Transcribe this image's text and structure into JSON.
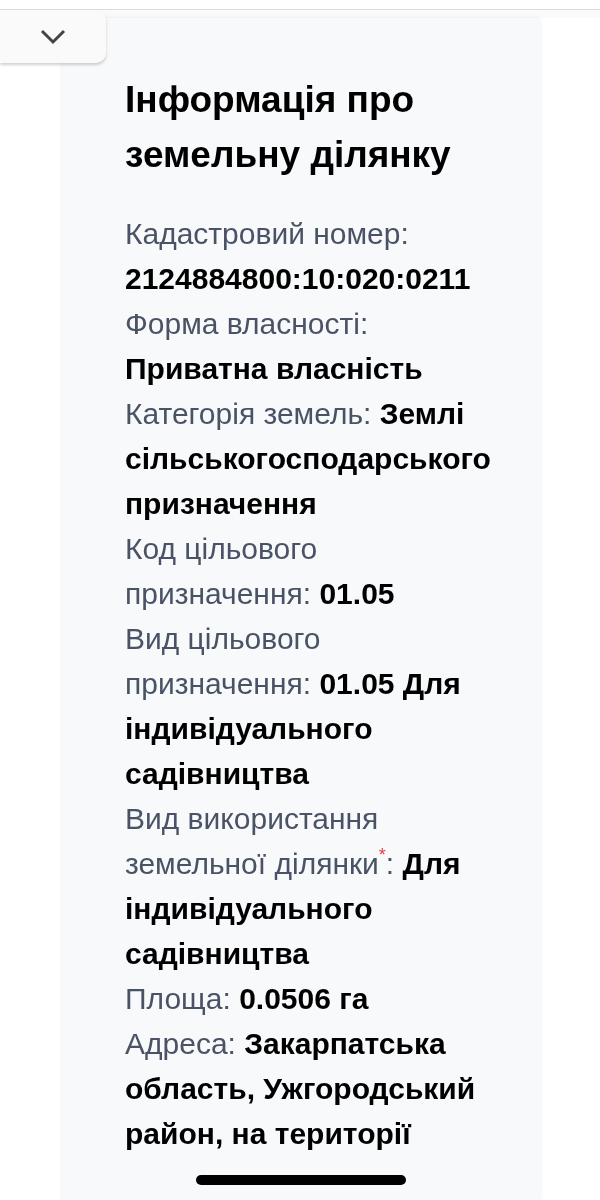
{
  "title": "Інформація про земельну ділянку",
  "fields": [
    {
      "label": "Кадастровий номер:",
      "value": "2124884800:10:020:0211"
    },
    {
      "label": "Форма власності:",
      "value": "Приватна власність"
    },
    {
      "label": "Категорія земель:",
      "value": "Землі сільськогосподарського призначення"
    },
    {
      "label": "Код цільового призначення:",
      "value": "01.05"
    },
    {
      "label": "Вид цільового призначення:",
      "value": "01.05 Для індивідуального садівництва"
    },
    {
      "label": "Вид використання земельної ділянки$^{*}$:",
      "value": "Для індивідуального садівництва"
    },
    {
      "label": "Площа:",
      "value": "0.0506 га"
    },
    {
      "label": "Адреса:",
      "value": "Закарпатська область, Ужгородський район, на території"
    }
  ]
}
